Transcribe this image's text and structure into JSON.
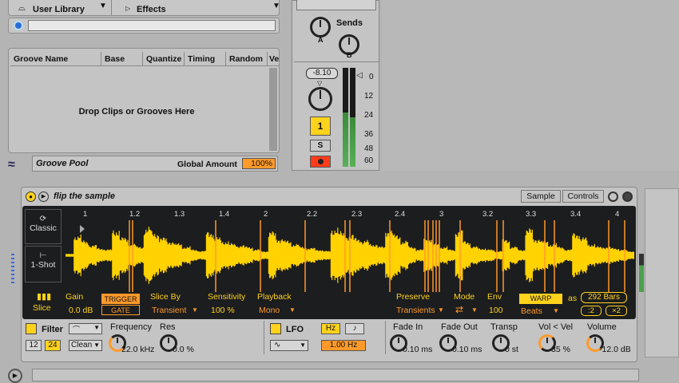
{
  "browser": {
    "user_library_label": "User Library",
    "effects_label": "Effects"
  },
  "groove_pool": {
    "columns": [
      "Groove Name",
      "Base",
      "Quantize",
      "Timing",
      "Random",
      "Ve"
    ],
    "drop_hint": "Drop Clips or Grooves Here",
    "title": "Groove Pool",
    "global_amount_label": "Global Amount",
    "global_amount_value": "100%"
  },
  "mixer": {
    "sends_label": "Sends",
    "send_a": "A",
    "send_b": "B",
    "volume_value": "-8.10",
    "track_button": "1",
    "solo_button": "S",
    "meter_scale": [
      "0",
      "12",
      "24",
      "36",
      "48",
      "60"
    ]
  },
  "clip": {
    "name": "flip the sample",
    "tab_sample": "Sample",
    "tab_controls": "Controls",
    "mode_classic": "Classic",
    "mode_oneshot": "1-Shot",
    "ruler": [
      "1",
      "1.2",
      "1.3",
      "1.4",
      "2",
      "2.2",
      "2.3",
      "2.4",
      "3",
      "3.2",
      "3.3",
      "3.4",
      "4"
    ],
    "slice_label": "Slice",
    "gain_label": "Gain",
    "gain_value": "0.0 dB",
    "trigger_label": "TRIGGER",
    "gate_label": "GATE",
    "slice_by_label": "Slice By",
    "slice_by_value": "Transient",
    "sensitivity_label": "Sensitivity",
    "sensitivity_value": "100 %",
    "playback_label": "Playback",
    "playback_value": "Mono",
    "preserve_label": "Preserve",
    "preserve_value": "Transients",
    "mode_label": "Mode",
    "env_label": "Env",
    "env_value": "100",
    "warp_label": "WARP",
    "warp_value": "Beats",
    "as_label": "as",
    "bars_value": "292 Bars",
    "half_label": ":2",
    "double_label": "×2"
  },
  "device": {
    "filter_label": "Filter",
    "filter_12": "12",
    "filter_24": "24",
    "filter_clean": "Clean",
    "frequency_label": "Frequency",
    "frequency_value": "22.0 kHz",
    "res_label": "Res",
    "res_value": "0.0 %",
    "lfo_label": "LFO",
    "hz_label": "Hz",
    "note_label": "♪",
    "lfo_rate": "1.00 Hz",
    "fade_in_label": "Fade In",
    "fade_in_value": "0.10 ms",
    "fade_out_label": "Fade Out",
    "fade_out_value": "0.10 ms",
    "transp_label": "Transp",
    "transp_value": "0 st",
    "vol_vel_label": "Vol < Vel",
    "vol_vel_value": "35 %",
    "volume_label": "Volume",
    "volume_value": "-12.0 dB"
  },
  "colors": {
    "accent": "#ffd21c",
    "orange": "#ff9a2a",
    "waveform": "#ffd200",
    "display_bg": "#1c1d1f"
  },
  "waveform_peaks": [
    0.05,
    0.7,
    0.5,
    0.35,
    0.25,
    0.2,
    0.9,
    0.6,
    0.4,
    0.3,
    0.95,
    0.8,
    0.6,
    0.5,
    0.4,
    0.3,
    0.2,
    0.15,
    0.85,
    0.6,
    0.5,
    0.4,
    0.35,
    0.3,
    0.2,
    0.15,
    0.8,
    0.6,
    0.5,
    0.4,
    0.3,
    0.25,
    0.2,
    0.15,
    0.95,
    0.8,
    0.7,
    0.6,
    0.5,
    0.4,
    0.3,
    0.9,
    0.7,
    0.5,
    0.3,
    0.2,
    0.6,
    0.4,
    0.3,
    0.2,
    0.85,
    0.5,
    0.3,
    0.25,
    0.2,
    0.15,
    0.55,
    0.3,
    0.2,
    0.9,
    0.6,
    0.5,
    0.4,
    0.3,
    0.2,
    0.8,
    0.6,
    0.4,
    0.3,
    0.3,
    0.25,
    0.2,
    0.15
  ]
}
